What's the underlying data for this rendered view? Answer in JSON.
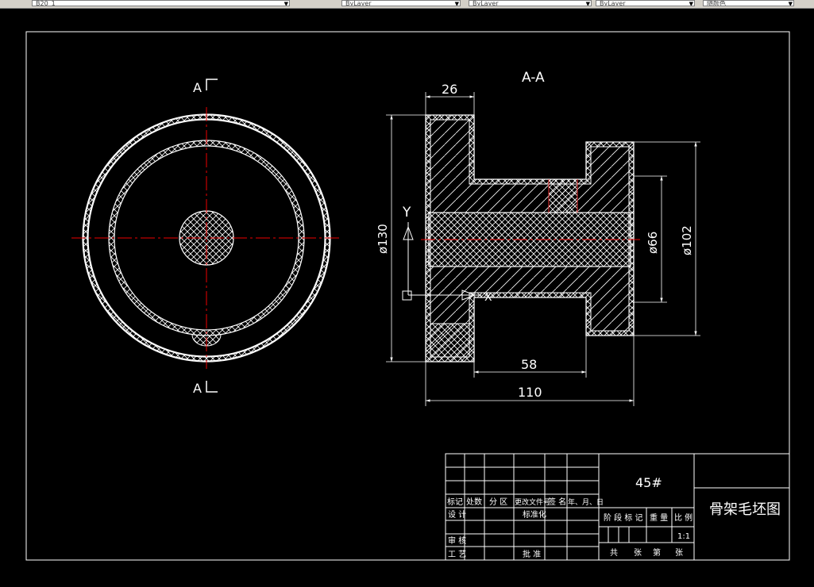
{
  "toolbar": {
    "layer_combo": "B20_1",
    "color_combo": "ByLayer",
    "linetype_combo": "ByLayer",
    "lineweight_combo": "ByLayer",
    "plotstyle_combo": "随颜色"
  },
  "drawing": {
    "section_label": "A-A",
    "cut_mark_top": "A",
    "cut_mark_bottom": "A",
    "ucs_y": "Y",
    "ucs_x": "X",
    "dims": {
      "d26": "26",
      "d130": "ø130",
      "d66": "ø66",
      "d102": "ø102",
      "d58": "58",
      "d110": "110"
    }
  },
  "title_block": {
    "material": "45#",
    "part_name": "骨架毛坯图",
    "scale": "1:1",
    "hdr_mark": "标记",
    "hdr_count": "处数",
    "hdr_zone": "分 区",
    "hdr_doc": "更改文件号",
    "hdr_sign": "签 名",
    "hdr_date": "年、月、日",
    "lbl_design": "设 计",
    "lbl_standard": "标准化",
    "lbl_review": "审 核",
    "lbl_process": "工 艺",
    "lbl_approve": "批 准",
    "lbl_stage": "阶 段 标 记",
    "lbl_weight": "重 量",
    "lbl_ratio": "比 例",
    "lbl_total": "共",
    "lbl_sheet": "张",
    "lbl_no": "第",
    "lbl_sheet2": "张"
  }
}
